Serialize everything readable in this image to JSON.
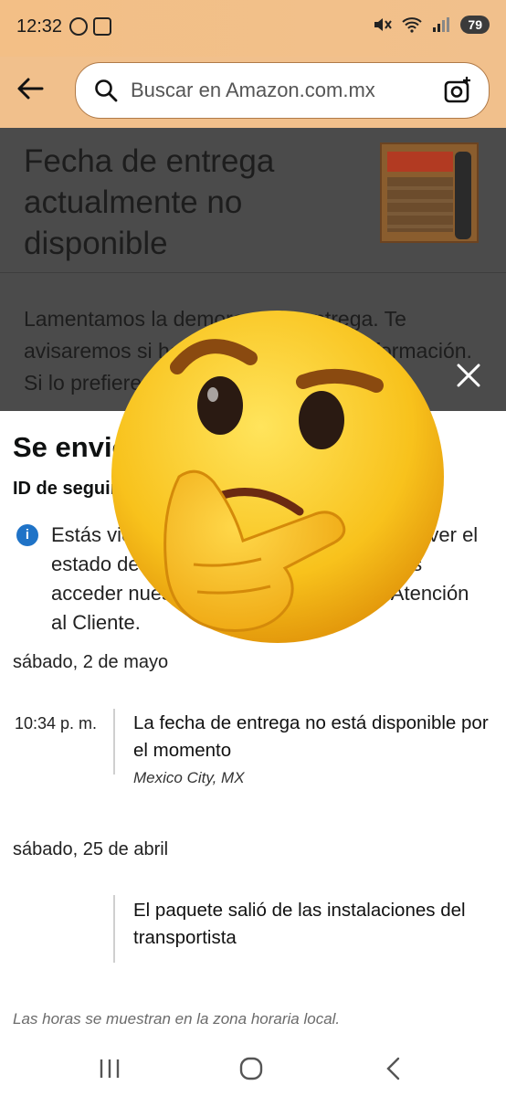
{
  "status_bar": {
    "time": "12:32",
    "battery": "79"
  },
  "header": {
    "search_placeholder": "Buscar en Amazon.com.mx"
  },
  "background": {
    "title": "Fecha de entrega actualmente no disponible",
    "body": "Lamentamos la demora en la entrega. Te avisaremos si hay novedades en la información. Si lo prefieres, te avisaremos si ..."
  },
  "sheet": {
    "title": "Se envió",
    "tracking_label": "ID de seguimiento",
    "info_text": "Estás viendo el estado de tu pedido. Para ver el estado de tu paquete y hacer que puedas acceder nuestros agentes, contacta a Atención al Cliente.",
    "days": [
      {
        "date": "sábado, 2 de mayo",
        "event": {
          "time": "10:34 p. m.",
          "description": "La fecha de entrega no está disponible por el momento",
          "location": "Mexico City, MX"
        }
      },
      {
        "date": "sábado, 25 de abril",
        "event": {
          "time": "",
          "description": "El paquete salió de las instalaciones del transportista",
          "location": ""
        }
      }
    ],
    "footnote": "Las horas se muestran en la zona horaria local."
  }
}
